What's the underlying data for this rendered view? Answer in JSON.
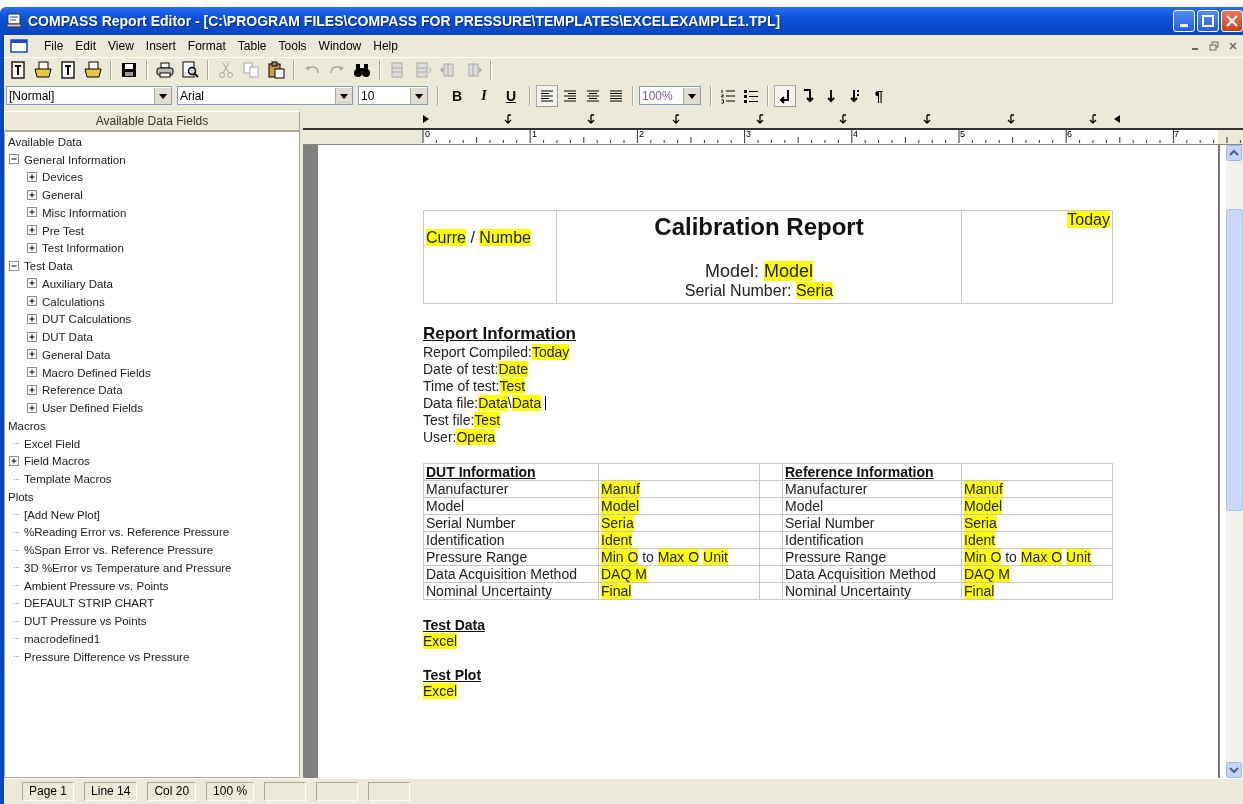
{
  "window": {
    "title": "COMPASS Report Editor - [C:\\PROGRAM FILES\\COMPASS FOR PRESSURE\\TEMPLATES\\EXCELEXAMPLE1.TPL]"
  },
  "menu": [
    "File",
    "Edit",
    "View",
    "Insert",
    "Format",
    "Table",
    "Tools",
    "Window",
    "Help"
  ],
  "toolbar": [
    {
      "kind": "report",
      "disabled": false
    },
    {
      "kind": "open-report",
      "disabled": false
    },
    {
      "kind": "template",
      "disabled": false
    },
    {
      "kind": "open-template",
      "disabled": false
    },
    {
      "kind": "separator"
    },
    {
      "kind": "save",
      "disabled": false
    },
    {
      "kind": "separator"
    },
    {
      "kind": "print",
      "disabled": false
    },
    {
      "kind": "preview",
      "disabled": false
    },
    {
      "kind": "separator"
    },
    {
      "kind": "cut",
      "disabled": true
    },
    {
      "kind": "copy",
      "disabled": true
    },
    {
      "kind": "paste",
      "disabled": false
    },
    {
      "kind": "separator"
    },
    {
      "kind": "undo",
      "disabled": true
    },
    {
      "kind": "redo",
      "disabled": true
    },
    {
      "kind": "find",
      "disabled": false
    },
    {
      "kind": "separator"
    },
    {
      "kind": "row",
      "disabled": true
    },
    {
      "kind": "row-insert",
      "disabled": true
    },
    {
      "kind": "col-left",
      "disabled": true
    },
    {
      "kind": "col-right",
      "disabled": true
    },
    {
      "kind": "separator"
    }
  ],
  "format_bar": [
    {
      "kind": "style-combo",
      "value": "[Normal]"
    },
    {
      "kind": "font-combo",
      "value": "Arial"
    },
    {
      "kind": "size-combo",
      "value": "10"
    },
    {
      "kind": "separator"
    },
    {
      "kind": "bold",
      "label": "B",
      "pressed": false
    },
    {
      "kind": "italic",
      "label": "I",
      "pressed": false
    },
    {
      "kind": "underline",
      "label": "U",
      "pressed": false
    },
    {
      "kind": "separator"
    },
    {
      "kind": "align-left",
      "pressed": true
    },
    {
      "kind": "align-right",
      "pressed": false
    },
    {
      "kind": "align-center",
      "pressed": false
    },
    {
      "kind": "justify",
      "pressed": false
    },
    {
      "kind": "separator"
    },
    {
      "kind": "zoom-combo",
      "value": "100%"
    },
    {
      "kind": "separator"
    },
    {
      "kind": "numbered-list",
      "pressed": false
    },
    {
      "kind": "bullet-list",
      "pressed": false
    },
    {
      "kind": "separator"
    },
    {
      "kind": "break-left",
      "pressed": true
    },
    {
      "kind": "break-right",
      "pressed": false
    },
    {
      "kind": "down",
      "pressed": false
    },
    {
      "kind": "down-dots",
      "pressed": false
    },
    {
      "kind": "pilcrow",
      "label": "¶",
      "pressed": false
    }
  ],
  "panel": {
    "title": "Available Data Fields"
  },
  "tree": [
    {
      "label": "Available Data",
      "children": [
        {
          "label": "General Information",
          "expanded": true,
          "children": [
            {
              "label": "Devices",
              "expanded": false
            },
            {
              "label": "General",
              "expanded": false
            },
            {
              "label": "Misc Information",
              "expanded": false
            },
            {
              "label": "Pre Test",
              "expanded": false
            },
            {
              "label": "Test Information",
              "expanded": false
            }
          ]
        },
        {
          "label": "Test Data",
          "expanded": true,
          "children": [
            {
              "label": "Auxiliary Data",
              "expanded": false
            },
            {
              "label": "Calculations",
              "expanded": false
            },
            {
              "label": "DUT Calculations",
              "expanded": false
            },
            {
              "label": "DUT Data",
              "expanded": false
            },
            {
              "label": "General Data",
              "expanded": false
            },
            {
              "label": "Macro Defined Fields",
              "expanded": false
            },
            {
              "label": "Reference Data",
              "expanded": false
            },
            {
              "label": "User Defined Fields",
              "expanded": false
            }
          ]
        }
      ]
    },
    {
      "label": "Macros",
      "children": [
        {
          "label": "Excel Field"
        },
        {
          "label": "Field Macros",
          "expanded": false
        },
        {
          "label": "Template Macros"
        }
      ]
    },
    {
      "label": "Plots",
      "children": [
        {
          "label": " [Add New Plot]"
        },
        {
          "label": "%Reading Error vs. Reference Pressure"
        },
        {
          "label": "%Span Error vs. Reference Pressure"
        },
        {
          "label": "3D %Error vs Temperature and Pressure"
        },
        {
          "label": "Ambient Pressure vs. Points"
        },
        {
          "label": "DEFAULT STRIP CHART"
        },
        {
          "label": "DUT Pressure vs Points"
        },
        {
          "label": "macrodefined1"
        },
        {
          "label": "Pressure Difference vs Pressure"
        }
      ]
    }
  ],
  "ruler": {
    "labels": [
      "0",
      "1",
      "2",
      "3",
      "4",
      "5",
      "6",
      "7"
    ]
  },
  "report": {
    "header": {
      "left": [
        {
          "text": "Curre",
          "field": true
        },
        {
          "text": " / ",
          "field": false
        },
        {
          "text": "Numbe",
          "field": true
        }
      ],
      "title": "Calibration Report",
      "model": [
        {
          "text": "Model: ",
          "field": false
        },
        {
          "text": "Model",
          "field": true
        }
      ],
      "serial": [
        {
          "text": "Serial Number: ",
          "field": false
        },
        {
          "text": "Seria",
          "field": true
        }
      ],
      "right": [
        {
          "text": "Today",
          "field": true
        }
      ]
    },
    "info_heading": "Report Information",
    "info_lines": [
      {
        "segments": [
          {
            "text": "Report Compiled:",
            "field": false
          },
          {
            "text": "Today",
            "field": true
          }
        ],
        "caret": false
      },
      {
        "segments": [
          {
            "text": "Date of test:",
            "field": false
          },
          {
            "text": "Date",
            "field": true
          }
        ],
        "caret": false
      },
      {
        "segments": [
          {
            "text": "Time of test:",
            "field": false
          },
          {
            "text": "Test",
            "field": true
          }
        ],
        "caret": false
      },
      {
        "segments": [
          {
            "text": "Data file:",
            "field": false
          },
          {
            "text": "Data",
            "field": true
          },
          {
            "text": "\\",
            "field": false
          },
          {
            "text": "Data",
            "field": true
          }
        ],
        "caret": true
      },
      {
        "segments": [
          {
            "text": "Test file:",
            "field": false
          },
          {
            "text": "Test",
            "field": true
          }
        ],
        "caret": false
      },
      {
        "segments": [
          {
            "text": "User:",
            "field": false
          },
          {
            "text": "Opera",
            "field": true
          }
        ],
        "caret": false
      }
    ],
    "device_table": [
      {
        "kind": "heading",
        "left": {
          "label": "DUT Information"
        },
        "right": {
          "label": "Reference Information"
        }
      },
      {
        "kind": "data",
        "left": {
          "label": "Manufacturer",
          "value": [
            {
              "text": "Manuf",
              "field": true
            }
          ]
        },
        "right": {
          "label": "Manufacturer",
          "value": [
            {
              "text": "Manuf",
              "field": true
            }
          ]
        }
      },
      {
        "kind": "data",
        "left": {
          "label": "Model",
          "value": [
            {
              "text": "Model",
              "field": true
            }
          ]
        },
        "right": {
          "label": "Model",
          "value": [
            {
              "text": "Model",
              "field": true
            }
          ]
        }
      },
      {
        "kind": "data",
        "left": {
          "label": "Serial Number",
          "value": [
            {
              "text": "Seria",
              "field": true
            }
          ]
        },
        "right": {
          "label": "Serial Number",
          "value": [
            {
              "text": "Seria",
              "field": true
            }
          ]
        }
      },
      {
        "kind": "data",
        "left": {
          "label": "Identification",
          "value": [
            {
              "text": "Ident",
              "field": true
            }
          ]
        },
        "right": {
          "label": "Identification",
          "value": [
            {
              "text": "Ident",
              "field": true
            }
          ]
        }
      },
      {
        "kind": "data",
        "left": {
          "label": "Pressure Range",
          "value": [
            {
              "text": "Min O",
              "field": true
            },
            {
              "text": " to ",
              "field": false
            },
            {
              "text": "Max O",
              "field": true
            },
            {
              "text": "Unit",
              "field": true
            }
          ]
        },
        "right": {
          "label": "Pressure Range",
          "value": [
            {
              "text": "Min O",
              "field": true
            },
            {
              "text": " to ",
              "field": false
            },
            {
              "text": "Max O",
              "field": true
            },
            {
              "text": "Unit",
              "field": true
            }
          ]
        }
      },
      {
        "kind": "data",
        "left": {
          "label": "Data Acquisition Method",
          "value": [
            {
              "text": "DAQ M",
              "field": true
            }
          ]
        },
        "right": {
          "label": "Data Acquisition Method",
          "value": [
            {
              "text": "DAQ M",
              "field": true
            }
          ]
        }
      },
      {
        "kind": "data",
        "left": {
          "label": "Nominal Uncertainty",
          "value": [
            {
              "text": "Final",
              "field": true
            }
          ]
        },
        "right": {
          "label": "Nominal Uncertainty",
          "value": [
            {
              "text": "Final",
              "field": true
            }
          ]
        }
      }
    ],
    "sections": [
      {
        "heading": "Test Data",
        "value": [
          {
            "text": "Excel",
            "field": true
          }
        ]
      },
      {
        "heading": "Test Plot",
        "value": [
          {
            "text": "Excel",
            "field": true
          }
        ]
      }
    ]
  },
  "status_bar": [
    "Page  1",
    "Line  14",
    "Col  20",
    "100 %"
  ]
}
